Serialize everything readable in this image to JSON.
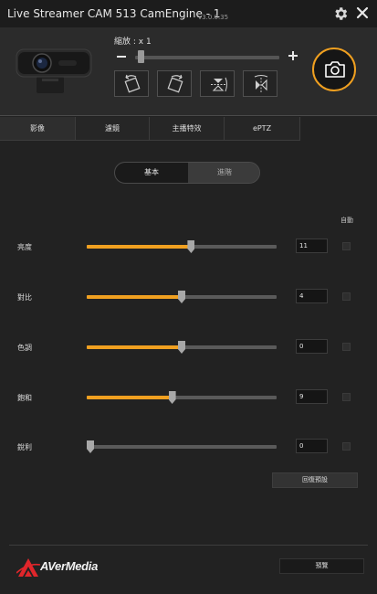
{
  "window": {
    "title": "Live Streamer CAM 513 CamEngine - 1",
    "version": "v3.0.0.35"
  },
  "camera_panel": {
    "zoom_label": "縮放 : x 1",
    "zoom_level": 1,
    "zoom_slider_fraction": 0.02,
    "transform_buttons": [
      {
        "icon": "rotate-left-icon"
      },
      {
        "icon": "rotate-right-icon"
      },
      {
        "icon": "flip-vertical-icon"
      },
      {
        "icon": "flip-horizontal-icon"
      }
    ],
    "snapshot_icon": "camera-icon",
    "accent_color": "#f0a020"
  },
  "tabs": [
    {
      "label": "影像",
      "active": true
    },
    {
      "label": "濾鏡",
      "active": false
    },
    {
      "label": "主播特效",
      "active": false
    },
    {
      "label": "ePTZ",
      "active": false
    }
  ],
  "mode_toggle": {
    "basic": "基本",
    "advanced": "進階",
    "selected": "基本"
  },
  "auto_header": "自動",
  "settings": [
    {
      "label": "亮度",
      "value": "11",
      "fraction": 0.55,
      "auto": false
    },
    {
      "label": "對比",
      "value": "4",
      "fraction": 0.5,
      "auto": false
    },
    {
      "label": "色調",
      "value": "0",
      "fraction": 0.5,
      "auto": false
    },
    {
      "label": "飽和",
      "value": "9",
      "fraction": 0.45,
      "auto": false
    },
    {
      "label": "銳利",
      "value": "0",
      "fraction": 0.0,
      "auto": false
    }
  ],
  "reset_button": "回復預設",
  "footer": {
    "brand": "AVerMedia",
    "logo_color": "#e0262b",
    "preview_button": "預覽"
  }
}
